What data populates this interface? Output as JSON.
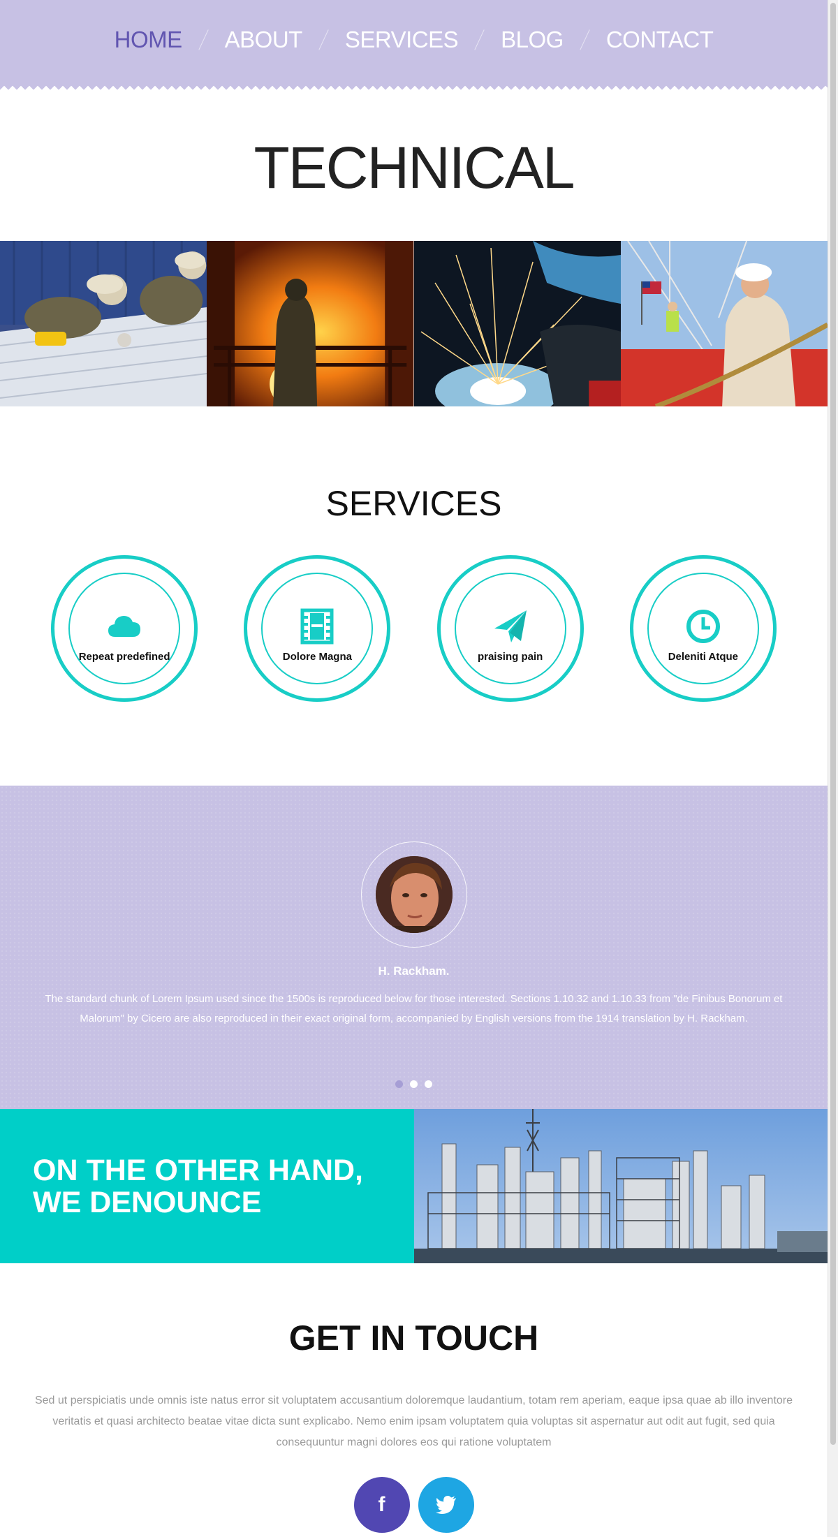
{
  "nav": {
    "items": [
      {
        "label": "HOME",
        "active": true
      },
      {
        "label": "ABOUT",
        "active": false
      },
      {
        "label": "SERVICES",
        "active": false
      },
      {
        "label": "BLOG",
        "active": false
      },
      {
        "label": "CONTACT",
        "active": false
      }
    ]
  },
  "hero": {
    "title": "TECHNICAL"
  },
  "photos": [
    {
      "icon": "roof-workers-photo"
    },
    {
      "icon": "foundry-worker-photo"
    },
    {
      "icon": "welding-sparks-photo"
    },
    {
      "icon": "crane-worker-photo"
    }
  ],
  "services": {
    "title": "SERVICES",
    "items": [
      {
        "label": "Repeat predefined",
        "icon": "cloud-icon"
      },
      {
        "label": "Dolore Magna",
        "icon": "film-icon"
      },
      {
        "label": "praising pain",
        "icon": "paper-plane-icon"
      },
      {
        "label": "Deleniti Atque",
        "icon": "clock-icon"
      }
    ]
  },
  "testimonial": {
    "name": "H. Rackham.",
    "text": "The standard chunk of Lorem Ipsum used since the 1500s is reproduced below for those interested. Sections 1.10.32 and 1.10.33 from \"de Finibus Bonorum et Malorum\" by Cicero are also reproduced in their exact original form, accompanied by English versions from the 1914 translation by H. Rackham.",
    "active_dot": 0,
    "dot_count": 3
  },
  "banner": {
    "line1": "ON THE OTHER HAND,",
    "line2": "WE DENOUNCE"
  },
  "contact": {
    "title": "GET IN TOUCH",
    "text": "Sed ut perspiciatis unde omnis iste natus error sit voluptatem accusantium doloremque laudantium, totam rem aperiam, eaque ipsa quae ab illo inventore veritatis et quasi architecto beatae vitae dicta sunt explicabo. Nemo enim ipsam voluptatem quia voluptas sit aspernatur aut odit aut fugit, sed quia consequuntur magni dolores eos qui ratione voluptatem",
    "socials": [
      {
        "label": "f",
        "icon": "facebook-icon"
      },
      {
        "label": "",
        "icon": "twitter-icon"
      }
    ]
  },
  "colors": {
    "lavender": "#c7c1e4",
    "nav_active": "#6155b0",
    "teal": "#18cdc6",
    "banner_teal": "#00cfc8",
    "facebook": "#5147b2",
    "twitter": "#1ea6e3"
  }
}
